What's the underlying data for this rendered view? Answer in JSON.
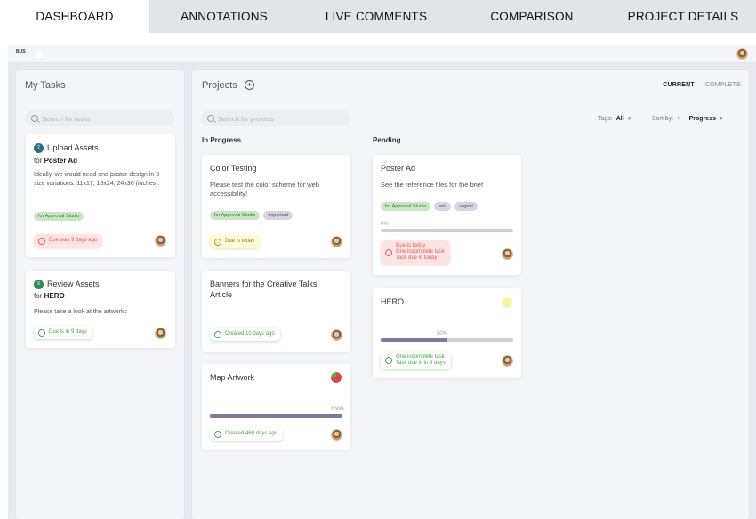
{
  "nav": {
    "tabs": [
      "DASHBOARD",
      "ANNOTATIONS",
      "LIVE COMMENTS",
      "COMPARISON",
      "PROJECT DETAILS"
    ]
  },
  "app": {
    "logo_text": "BUS"
  },
  "tasks": {
    "title": "My Tasks",
    "search_placeholder": "Search for tasks",
    "cards": [
      {
        "title": "Upload Assets",
        "for_prefix": "for",
        "for_target": "Poster Ad",
        "description": "Ideally, we would need one poster design in 3 size variations: 11x17, 18x24, 24x36 (inches).",
        "tag": "for Approval Studio",
        "status": "Due was 9 days ago"
      },
      {
        "title": "Review Assets",
        "for_prefix": "for",
        "for_target": "HERO",
        "description": "Please take a look at the artworks",
        "status": "Due is in 9 days"
      }
    ]
  },
  "projects": {
    "title": "Projects",
    "search_placeholder": "Search for projects",
    "subtabs": {
      "current": "CURRENT",
      "complete": "COMPLETE"
    },
    "filters": {
      "tags_label": "Tags:",
      "tags_value": "All",
      "sort_label": "Sort by:",
      "sort_value": "Progress"
    },
    "in_progress": {
      "heading": "In Progress",
      "cards": [
        {
          "title": "Color Testing",
          "description": "Please test the color scheme for web accessibility!",
          "tags": [
            "for Approval Studio",
            "important"
          ],
          "status": "Due is today"
        },
        {
          "title": "Banners for the Creative Talks Article",
          "status": "Created 10 days ago"
        },
        {
          "title": "Map Artwork",
          "progress": 100,
          "progress_label": "100%",
          "status": "Created 460 days ago"
        }
      ]
    },
    "pending": {
      "heading": "Pending",
      "cards": [
        {
          "title": "Poster Ad",
          "description": "See the reference files for the brief",
          "tags": [
            "for Approval Studio",
            "ads",
            "urgent"
          ],
          "progress": 0,
          "progress_label": "0%",
          "status_lines": [
            "Due is today",
            "One incomplete task",
            "Task due is today"
          ]
        },
        {
          "title": "HERO",
          "progress": 50,
          "progress_label": "50%",
          "status_lines": [
            "One incomplete task",
            "Task due is in 9 days"
          ]
        }
      ]
    }
  },
  "colors": {
    "accent_progress": "#7a7c98",
    "status_red": "#d66060",
    "status_green": "#4aa54a"
  }
}
